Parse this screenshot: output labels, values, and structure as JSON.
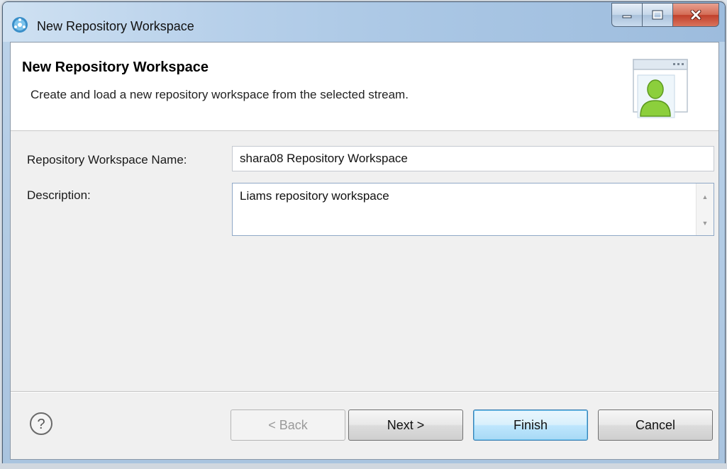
{
  "window": {
    "title": "New Repository Workspace",
    "icon": "rtc-logo-icon"
  },
  "banner": {
    "title": "New Repository Workspace",
    "description": "Create and load a new repository workspace from the selected stream.",
    "image": "workspace-user-icon"
  },
  "form": {
    "name_label": "Repository Workspace Name:",
    "name_value": "shara08 Repository Workspace",
    "description_label": "Description:",
    "description_value": "Liams repository workspace"
  },
  "buttons": {
    "back": "< Back",
    "next": "Next >",
    "finish": "Finish",
    "cancel": "Cancel",
    "help": "help-icon"
  },
  "colors": {
    "close_button": "#c0402b",
    "default_button_border": "#3c7fb1",
    "titlebar": "#b7d0ea"
  }
}
